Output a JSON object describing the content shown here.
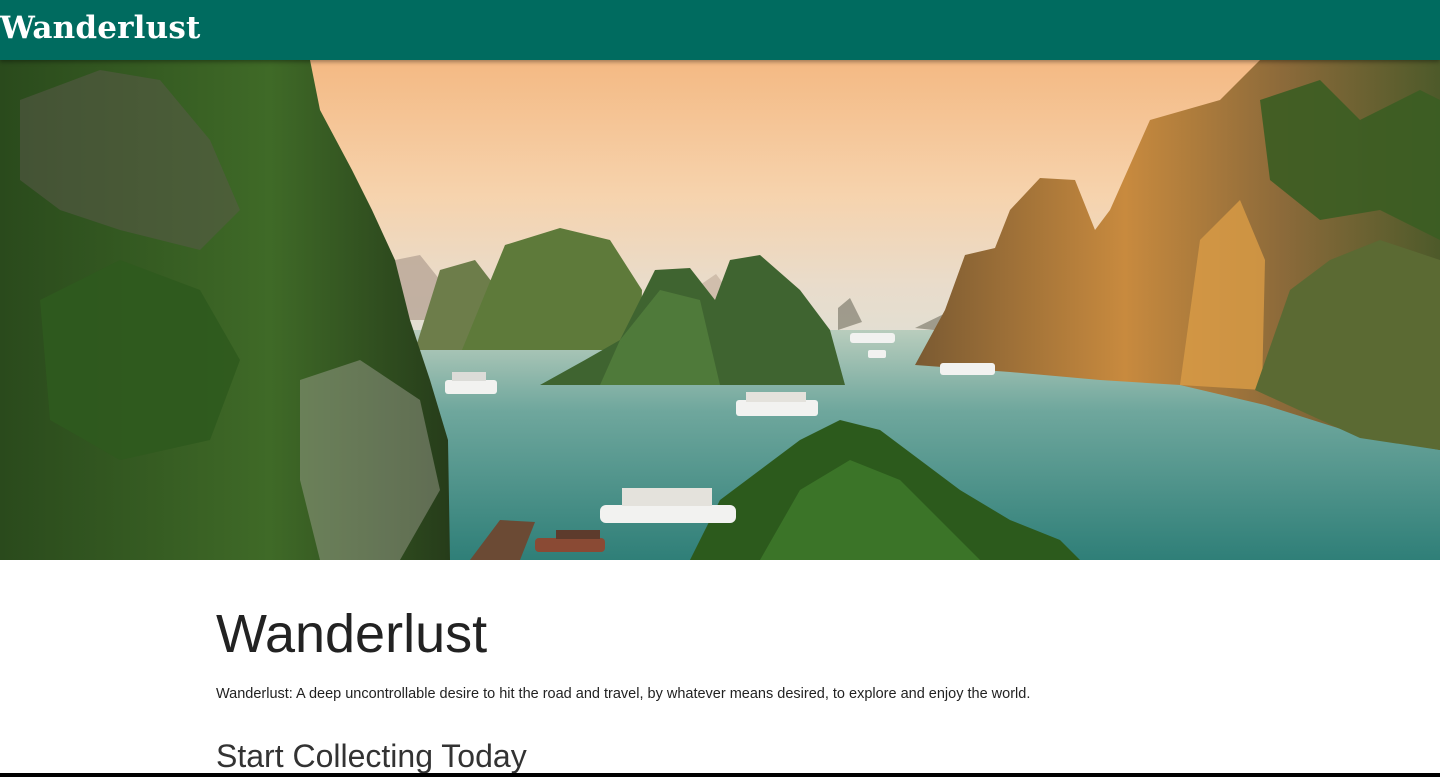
{
  "header": {
    "brand": "Wanderlust",
    "background_color": "#006b5f"
  },
  "hero": {
    "image_description_icon": "landscape-photo"
  },
  "main": {
    "title": "Wanderlust",
    "definition": "Wanderlust: A deep uncontrollable desire to hit the road and travel, by whatever means desired, to explore and enjoy the world.",
    "section_title": "Start Collecting Today"
  }
}
